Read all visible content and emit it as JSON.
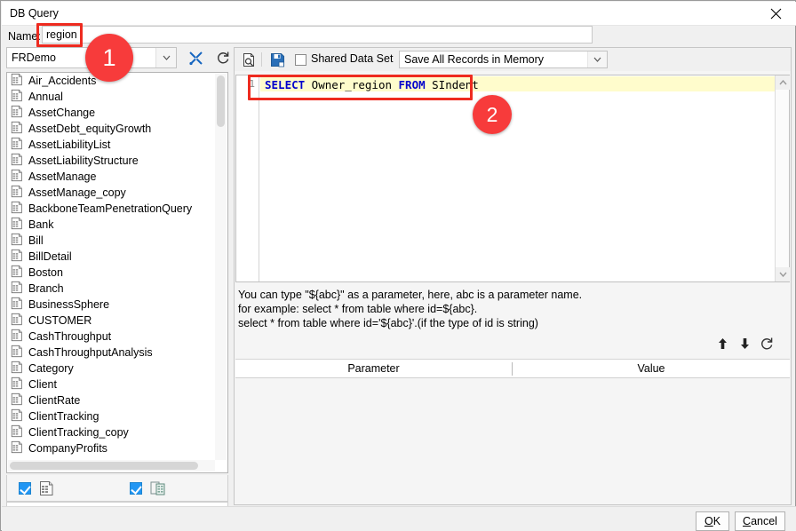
{
  "window": {
    "title": "DB Query",
    "close_icon": "close-icon"
  },
  "name_field": {
    "label": "Name:",
    "value": "region",
    "placeholder": ""
  },
  "left": {
    "connection": {
      "value": "FRDemo",
      "arrow_icon": "chevron-down-icon"
    },
    "tools": [
      {
        "name": "edit-datasource-button",
        "icon": "wrench-screwdriver-icon"
      },
      {
        "name": "refresh-datasource-button",
        "icon": "refresh-icon"
      }
    ],
    "overflow_icons": [
      "chevron-left-icon",
      "chevron-right-icon"
    ],
    "tables": [
      "Air_Accidents",
      "Annual",
      "AssetChange",
      "AssetDebt_equityGrowth",
      "AssetLiabilityList",
      "AssetLiabilityStructure",
      "AssetManage",
      "AssetManage_copy",
      "BackboneTeamPenetrationQuery",
      "Bank",
      "Bill",
      "BillDetail",
      "Boston",
      "Branch",
      "BusinessSphere",
      "CUSTOMER",
      "CashThroughput",
      "CashThroughputAnalysis",
      "Category",
      "Client",
      "ClientRate",
      "ClientTracking",
      "ClientTracking_copy",
      "CompanyProfits"
    ],
    "table_icon": "table-icon",
    "options": [
      {
        "name": "show-tables-checkbox",
        "checked": true,
        "icon": "table-icon"
      },
      {
        "name": "show-views-checkbox",
        "checked": true,
        "icon": "view-icon"
      }
    ]
  },
  "right": {
    "toolbar": {
      "preview_icon": "preview-search-icon",
      "save_icon": "save-icon",
      "shared_data_set": {
        "label": "Shared Data Set",
        "checked": false
      },
      "memory_select": {
        "value": "Save All Records in Memory",
        "arrow_icon": "chevron-down-icon"
      }
    },
    "editor": {
      "line_number": "1",
      "sql_tokens": [
        {
          "t": "SELECT",
          "kw": true
        },
        {
          "t": " Owner_region ",
          "kw": false
        },
        {
          "t": "FROM",
          "kw": true
        },
        {
          "t": " SIndent",
          "kw": false
        }
      ],
      "sql_text": "SELECT Owner_region FROM SIndent",
      "scroll_up_icon": "chevron-up-icon",
      "scroll_down_icon": "chevron-down-icon"
    },
    "help_lines": [
      "You can type \"${abc}\" as a parameter, here, abc is a parameter name.",
      "for example: select * from table where id=${abc}.",
      "select * from table where id='${abc}'.(if the type of id is string)"
    ],
    "param_tools": [
      {
        "name": "move-up-button",
        "icon": "arrow-up-icon"
      },
      {
        "name": "move-down-button",
        "icon": "arrow-down-icon"
      },
      {
        "name": "refresh-parameters-button",
        "icon": "refresh-icon"
      }
    ],
    "param_table": {
      "columns": [
        "Parameter",
        "Value"
      ],
      "rows": []
    }
  },
  "footer": {
    "ok": {
      "pre": "",
      "mnemonic": "O",
      "post": "K"
    },
    "cancel": {
      "pre": "",
      "mnemonic": "C",
      "post": "ancel"
    }
  },
  "annotations": [
    {
      "label": "1",
      "target": "name-field"
    },
    {
      "label": "2",
      "target": "sql-editor-line"
    }
  ]
}
